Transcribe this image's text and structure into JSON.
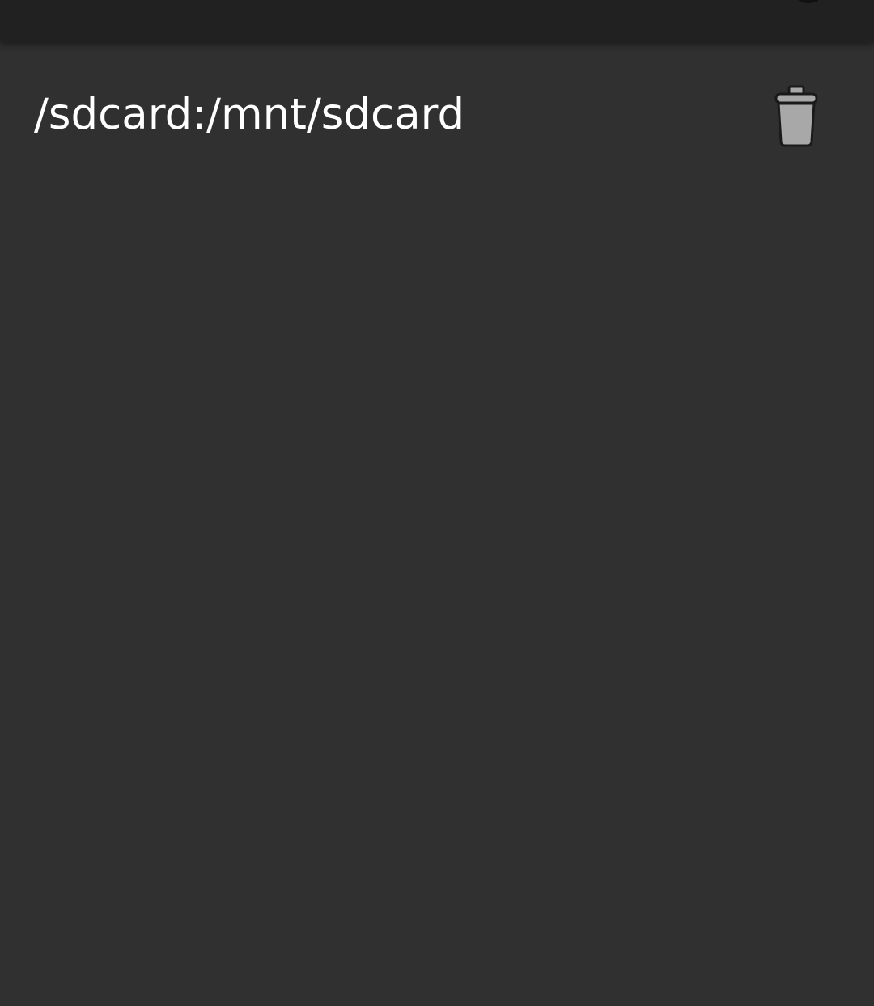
{
  "storage": {
    "path_label": "/sdcard:/mnt/sdcard",
    "delete_icon": "trash-icon"
  },
  "colors": {
    "background": "#303030",
    "toolbar": "#212121",
    "text": "#ffffff",
    "icon_fill": "#a8a8a8"
  }
}
